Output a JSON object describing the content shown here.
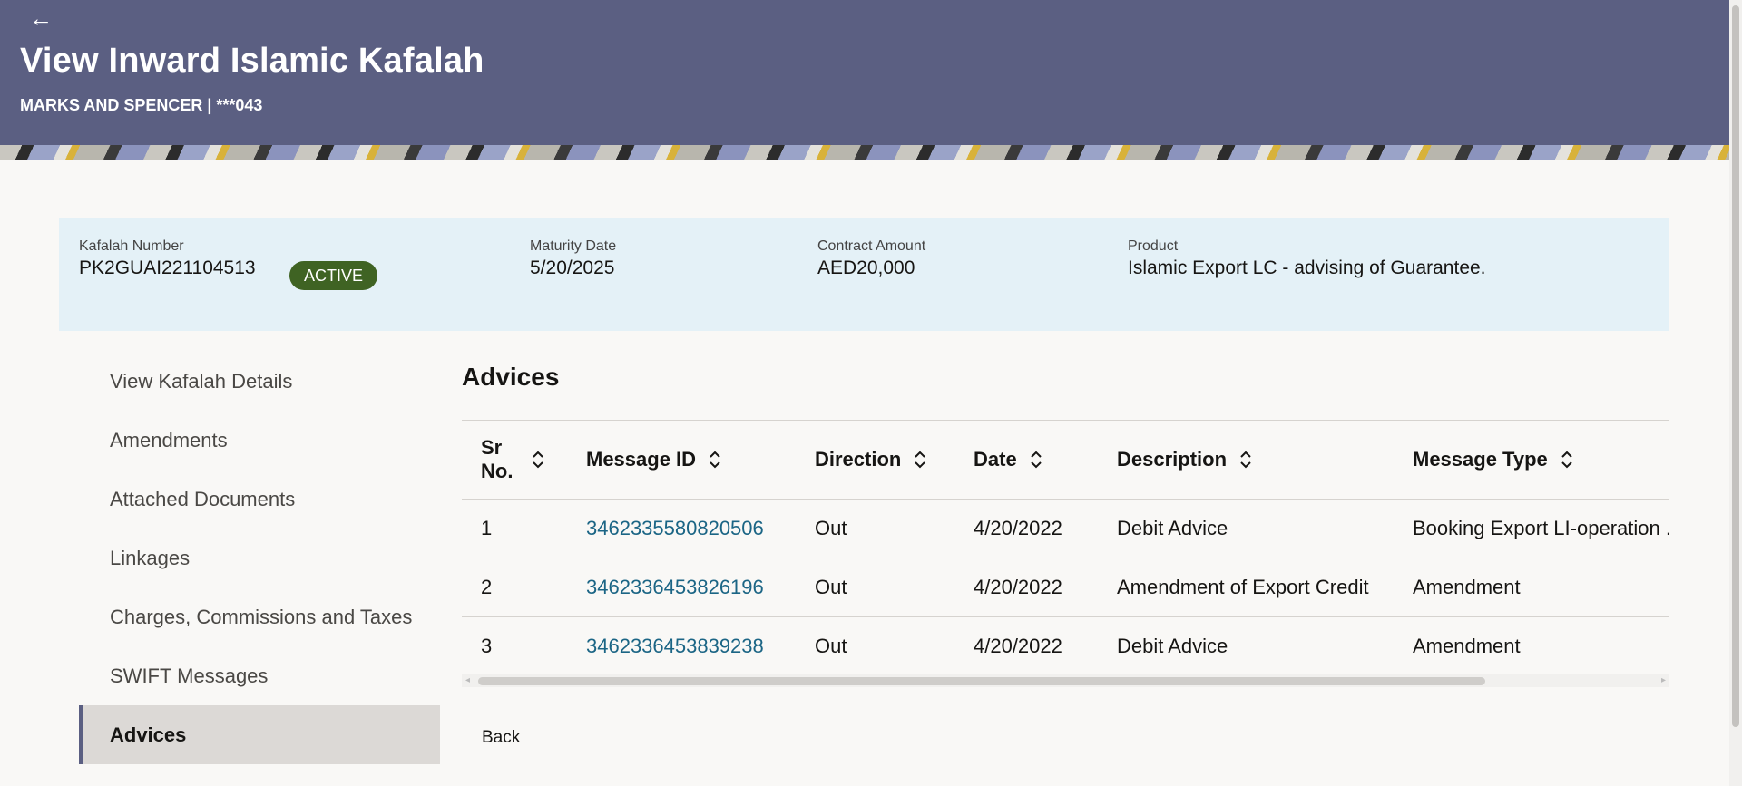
{
  "header": {
    "title": "View Inward Islamic Kafalah",
    "subtitle": "MARKS AND SPENCER | ***043"
  },
  "summary": {
    "kafalah_number_label": "Kafalah Number",
    "kafalah_number": "PK2GUAI221104513",
    "status": "ACTIVE",
    "maturity_date_label": "Maturity Date",
    "maturity_date": "5/20/2025",
    "contract_amount_label": "Contract Amount",
    "contract_amount": "AED20,000",
    "product_label": "Product",
    "product": "Islamic Export LC - advising of Guarantee."
  },
  "sidebar": {
    "items": [
      {
        "label": "View Kafalah Details"
      },
      {
        "label": "Amendments"
      },
      {
        "label": "Attached Documents"
      },
      {
        "label": "Linkages"
      },
      {
        "label": "Charges, Commissions and Taxes"
      },
      {
        "label": "SWIFT Messages"
      },
      {
        "label": "Advices"
      }
    ],
    "active": "Advices"
  },
  "main": {
    "section_title": "Advices",
    "columns": [
      "Sr No.",
      "Message ID",
      "Direction",
      "Date",
      "Description",
      "Message Type"
    ],
    "rows": [
      {
        "sr": "1",
        "message_id": "3462335580820506",
        "direction": "Out",
        "date": "4/20/2022",
        "description": "Debit Advice",
        "message_type": "Booking Export LI-operation ..."
      },
      {
        "sr": "2",
        "message_id": "3462336453826196",
        "direction": "Out",
        "date": "4/20/2022",
        "description": "Amendment of Export Credit",
        "message_type": "Amendment"
      },
      {
        "sr": "3",
        "message_id": "3462336453839238",
        "direction": "Out",
        "date": "4/20/2022",
        "description": "Debit Advice",
        "message_type": "Amendment"
      }
    ],
    "back_label": "Back"
  },
  "colors": {
    "header_bg": "#5b5f82",
    "summary_bg": "#e4f1f7",
    "status_badge": "#3f6323",
    "link": "#1b6585",
    "active_nav_bg": "#dcd9d6"
  },
  "icons": {
    "back": "arrow-left-icon",
    "sort": "sort-updown-icon"
  }
}
